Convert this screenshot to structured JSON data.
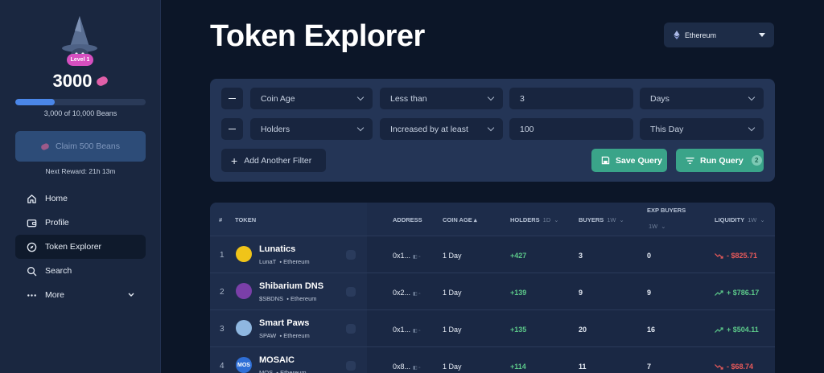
{
  "sidebar": {
    "level": "Level 1",
    "beans": "3000",
    "progress_text": "3,000 of 10,000 Beans",
    "progress_fraction": 0.3,
    "claim_label": "Claim 500 Beans",
    "next_reward_label": "Next Reward:",
    "next_reward_time": "21h 13m",
    "nav": [
      {
        "label": "Home",
        "icon": "home-icon"
      },
      {
        "label": "Profile",
        "icon": "wallet-icon"
      },
      {
        "label": "Token Explorer",
        "icon": "compass-icon",
        "active": true
      },
      {
        "label": "Search",
        "icon": "search-icon"
      },
      {
        "label": "More",
        "icon": "more-icon"
      }
    ]
  },
  "header": {
    "title": "Token Explorer",
    "chain": "Ethereum"
  },
  "filters": {
    "rows": [
      {
        "field": "Coin Age",
        "op": "Less than",
        "value": "3",
        "unit": "Days"
      },
      {
        "field": "Holders",
        "op": "Increased by at least",
        "value": "100",
        "unit": "This Day"
      }
    ],
    "add_label": "Add Another Filter",
    "save_label": "Save Query",
    "run_label": "Run Query",
    "run_count": "2"
  },
  "table": {
    "headers": {
      "rank": "#",
      "token": "TOKEN",
      "address": "ADDRESS",
      "coin_age": "COIN AGE",
      "holders": "HOLDERS",
      "holders_sub": "1D",
      "buyers": "BUYERS",
      "buyers_sub": "1W",
      "exp_buyers": "EXP BUYERS",
      "exp_buyers_sub": "1W",
      "liquidity": "LIQUIDITY",
      "liquidity_sub": "1W"
    },
    "rows": [
      {
        "rank": "1",
        "name": "Lunatics",
        "ticker": "LunaT",
        "chain": "Ethereum",
        "address": "0x1...",
        "age": "1 Day",
        "holders": "+427",
        "buyers": "3",
        "exp_buyers": "0",
        "liquidity": "- $825.71",
        "trend": "down",
        "logo_color": "#f0c419"
      },
      {
        "rank": "2",
        "name": "Shibarium DNS",
        "ticker": "$SBDNS",
        "chain": "Ethereum",
        "address": "0x2...",
        "age": "1 Day",
        "holders": "+139",
        "buyers": "9",
        "exp_buyers": "9",
        "liquidity": "+ $786.17",
        "trend": "up",
        "logo_color": "#7a3fa8"
      },
      {
        "rank": "3",
        "name": "Smart Paws",
        "ticker": "SPAW",
        "chain": "Ethereum",
        "address": "0x1...",
        "age": "1 Day",
        "holders": "+135",
        "buyers": "20",
        "exp_buyers": "16",
        "liquidity": "+ $504.11",
        "trend": "up",
        "logo_color": "#8fb7e0"
      },
      {
        "rank": "4",
        "name": "MOSAIC",
        "ticker": "MOS",
        "chain": "Ethereum",
        "address": "0x8...",
        "age": "1 Day",
        "holders": "+114",
        "buyers": "11",
        "exp_buyers": "7",
        "liquidity": "- $68.74",
        "trend": "down",
        "logo_color": "#2f6fd6",
        "logo_text": "MOS"
      }
    ]
  }
}
